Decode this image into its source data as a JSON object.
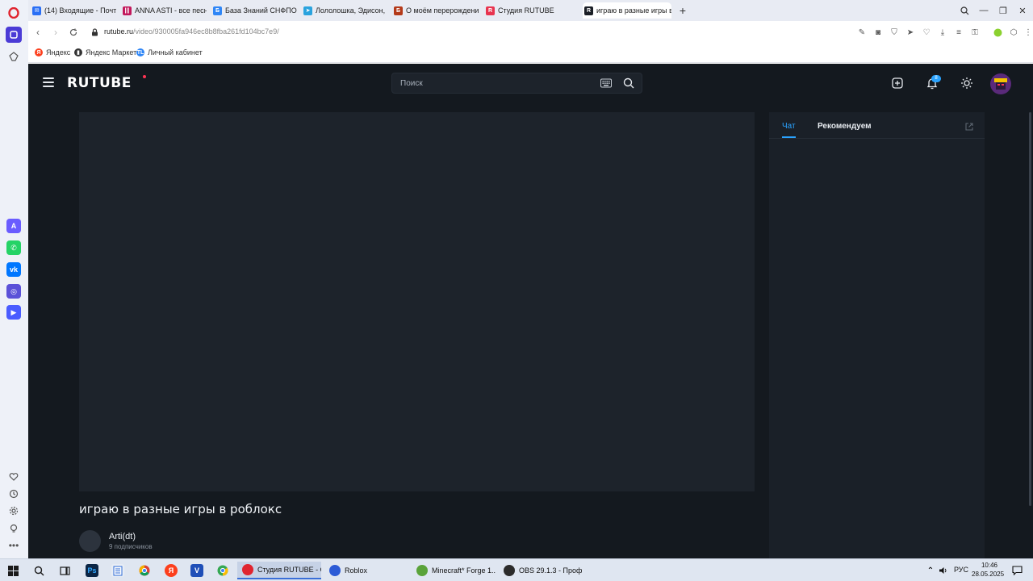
{
  "browser": {
    "tabs": [
      {
        "label": "(14) Входящие - Почта М",
        "icon_color": "#2a6ff5",
        "icon_char": "✉",
        "active": false
      },
      {
        "label": "ANNA ASTI - все песни,",
        "icon_color": "#c2185b",
        "icon_char": "|||",
        "active": false
      },
      {
        "label": "База Знаний СНФПО ПАО",
        "icon_color": "#2f86f6",
        "icon_char": "Б",
        "active": false
      },
      {
        "label": "Лололошка, Эдисон, Юн",
        "icon_color": "#2aa3de",
        "icon_char": "➤",
        "active": false
      },
      {
        "label": "О моём перерождении в",
        "icon_color": "#b43a1a",
        "icon_char": "Б",
        "active": false
      },
      {
        "label": "Студия RUTUBE",
        "icon_color": "#e8344f",
        "icon_char": "R",
        "active": false
      },
      {
        "label": "играю в разные игры в р",
        "icon_color": "#1b1f26",
        "icon_char": "R",
        "active": true
      }
    ],
    "address": {
      "host": "rutube.ru",
      "path": "/video/930005fa946ec8b8fba261fd104bc7e9/"
    },
    "bookmarks": [
      {
        "label": "Яндекс",
        "icon_color": "#fc3f1d",
        "icon_char": "Я"
      },
      {
        "label": "Яндекс Маркет",
        "icon_color": "#333333",
        "icon_char": "▮"
      },
      {
        "label": "Личный кабинет",
        "icon_color": "#2f86f6",
        "icon_char": "TL"
      }
    ],
    "sidebar_apps": [
      {
        "name": "aria-icon",
        "color": "#6a5cff",
        "char": "A"
      },
      {
        "name": "whatsapp-icon",
        "color": "#25d366",
        "char": "✆"
      },
      {
        "name": "vk-icon",
        "color": "#0077ff",
        "char": "vk"
      },
      {
        "name": "instagram-icon",
        "color": "#5b51d8",
        "char": "◎"
      },
      {
        "name": "player-icon",
        "color": "#4a5cff",
        "char": "▶"
      }
    ]
  },
  "rutube": {
    "logo": "RUTUBE",
    "search": {
      "placeholder": "Поиск"
    },
    "notifications_badge": "8",
    "side_tabs": {
      "chat": "Чат",
      "recommended": "Рекомендуем"
    },
    "video": {
      "title": "играю в разные игры в роблокс",
      "channel_name": "Arti(dt)",
      "subscribers": "9 подписчиков"
    },
    "colors": {
      "background": "#14191f",
      "player": "#1d232b",
      "accent": "#2aa3ff",
      "logo_dot": "#ff3454"
    }
  },
  "taskbar": {
    "apps": [
      {
        "label": "Студия RUTUBE - O...",
        "icon_color": "#e0242f",
        "active": true
      },
      {
        "label": "Roblox",
        "icon_color": "#2c5bd6",
        "active": false
      },
      {
        "label": "Minecraft* Forge 1....",
        "icon_color": "#5aa33a",
        "active": false
      },
      {
        "label": "OBS 29.1.3 - Проф...",
        "icon_color": "#2b2b2b",
        "active": false
      }
    ],
    "language": "РУС",
    "time": "10:46",
    "date": "28.05.2025"
  }
}
